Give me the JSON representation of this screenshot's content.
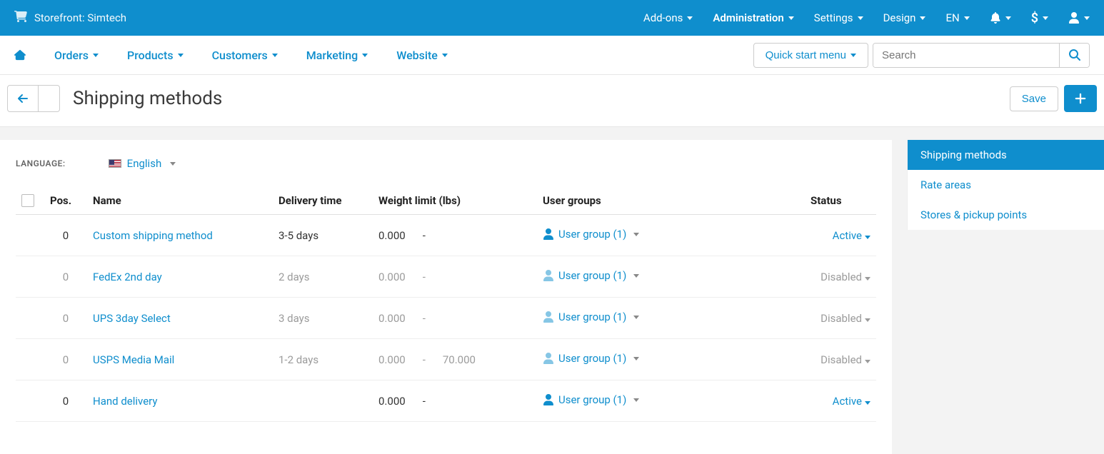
{
  "topbar": {
    "storefront_label": "Storefront: Simtech",
    "addons": "Add-ons",
    "administration": "Administration",
    "settings": "Settings",
    "design": "Design",
    "lang_short": "EN",
    "currency_symbol": "$"
  },
  "navbar": {
    "orders": "Orders",
    "products": "Products",
    "customers": "Customers",
    "marketing": "Marketing",
    "website": "Website",
    "quick_start": "Quick start menu",
    "search_placeholder": "Search"
  },
  "title": {
    "page_title": "Shipping methods",
    "save": "Save"
  },
  "lang": {
    "label": "LANGUAGE:",
    "value": "English"
  },
  "table": {
    "headers": {
      "pos": "Pos.",
      "name": "Name",
      "delivery": "Delivery time",
      "weight": "Weight limit (lbs)",
      "ug": "User groups",
      "status": "Status"
    },
    "rows": [
      {
        "pos": "0",
        "name": "Custom shipping method",
        "delivery": "3-5 days",
        "w_from": "0.000",
        "w_dash": "-",
        "w_to": "",
        "ug": "User group (1)",
        "status": "Active",
        "disabled": false
      },
      {
        "pos": "0",
        "name": "FedEx 2nd day",
        "delivery": "2 days",
        "w_from": "0.000",
        "w_dash": "-",
        "w_to": "",
        "ug": "User group (1)",
        "status": "Disabled",
        "disabled": true
      },
      {
        "pos": "0",
        "name": "UPS 3day Select",
        "delivery": "3 days",
        "w_from": "0.000",
        "w_dash": "-",
        "w_to": "",
        "ug": "User group (1)",
        "status": "Disabled",
        "disabled": true
      },
      {
        "pos": "0",
        "name": "USPS Media Mail",
        "delivery": "1-2 days",
        "w_from": "0.000",
        "w_dash": "-",
        "w_to": "70.000",
        "ug": "User group (1)",
        "status": "Disabled",
        "disabled": true
      },
      {
        "pos": "0",
        "name": "Hand delivery",
        "delivery": "",
        "w_from": "0.000",
        "w_dash": "-",
        "w_to": "",
        "ug": "User group (1)",
        "status": "Active",
        "disabled": false
      }
    ]
  },
  "sidebar": {
    "items": [
      {
        "label": "Shipping methods",
        "active": true
      },
      {
        "label": "Rate areas",
        "active": false
      },
      {
        "label": "Stores & pickup points",
        "active": false
      }
    ]
  }
}
